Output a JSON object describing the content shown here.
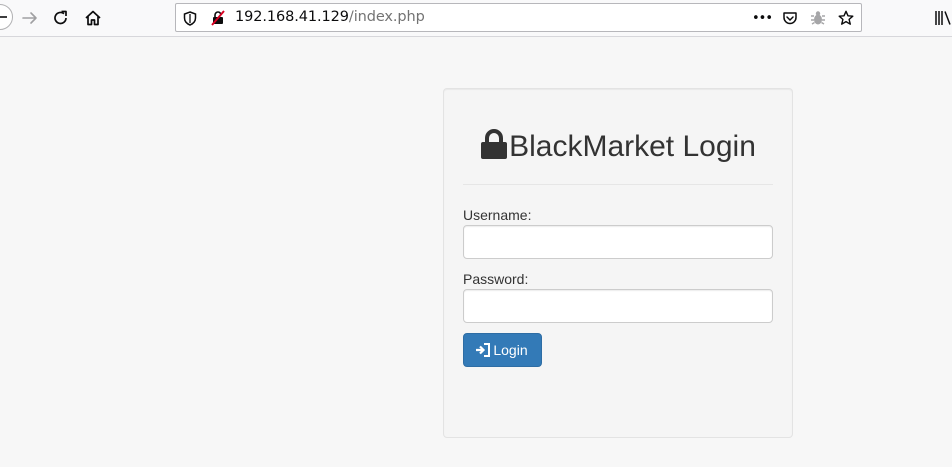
{
  "browser": {
    "url_host": "192.168.41.129",
    "url_path": "/index.php",
    "page_actions_label": "•••"
  },
  "login": {
    "title": "BlackMarket Login",
    "username_label": "Username:",
    "username_value": "",
    "password_label": "Password:",
    "password_value": "",
    "button_label": "Login"
  },
  "colors": {
    "page_bg": "#f7f7f7",
    "panel_bg": "#f5f5f5",
    "button_primary": "#337ab7",
    "text": "#333333"
  },
  "icons": [
    "back-arrow-icon",
    "forward-arrow-icon",
    "reload-icon",
    "home-icon",
    "tracking-shield-icon",
    "insecure-connection-icon",
    "page-actions-icon",
    "pocket-icon",
    "bug-icon",
    "bookmark-star-icon",
    "library-icon",
    "lock-icon",
    "sign-in-icon"
  ]
}
